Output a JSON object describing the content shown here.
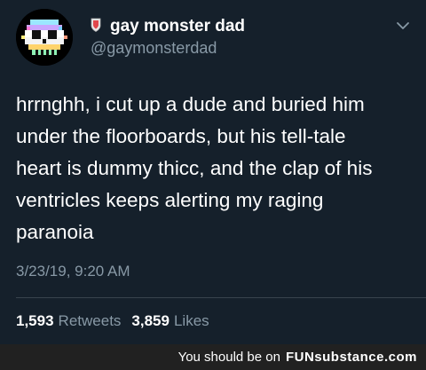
{
  "tweet": {
    "display_name": "gay monster dad",
    "handle": "@gaymonsterdad",
    "text": "hrrnghh, i cut up a dude and buried him\nunder the floorboards, but his tell-tale\nheart is dummy thicc, and the clap of his\nventricles keeps alerting my raging\nparanoia",
    "timestamp": "3/23/19, 9:20 AM",
    "retweets_count": "1,593",
    "retweets_label": "Retweets",
    "likes_count": "3,859",
    "likes_label": "Likes"
  },
  "footer": {
    "text": "You should be on",
    "brand_fun": "FUN",
    "brand_rest": "substance.com"
  },
  "colors": {
    "background": "#15202b",
    "secondary_text": "#8899a6",
    "divider": "#38444d",
    "footer_bg": "#212121"
  },
  "icons": {
    "avatar": "pixel-skull-avatar",
    "name_badge": "shield-icon",
    "menu": "chevron-down-icon"
  }
}
